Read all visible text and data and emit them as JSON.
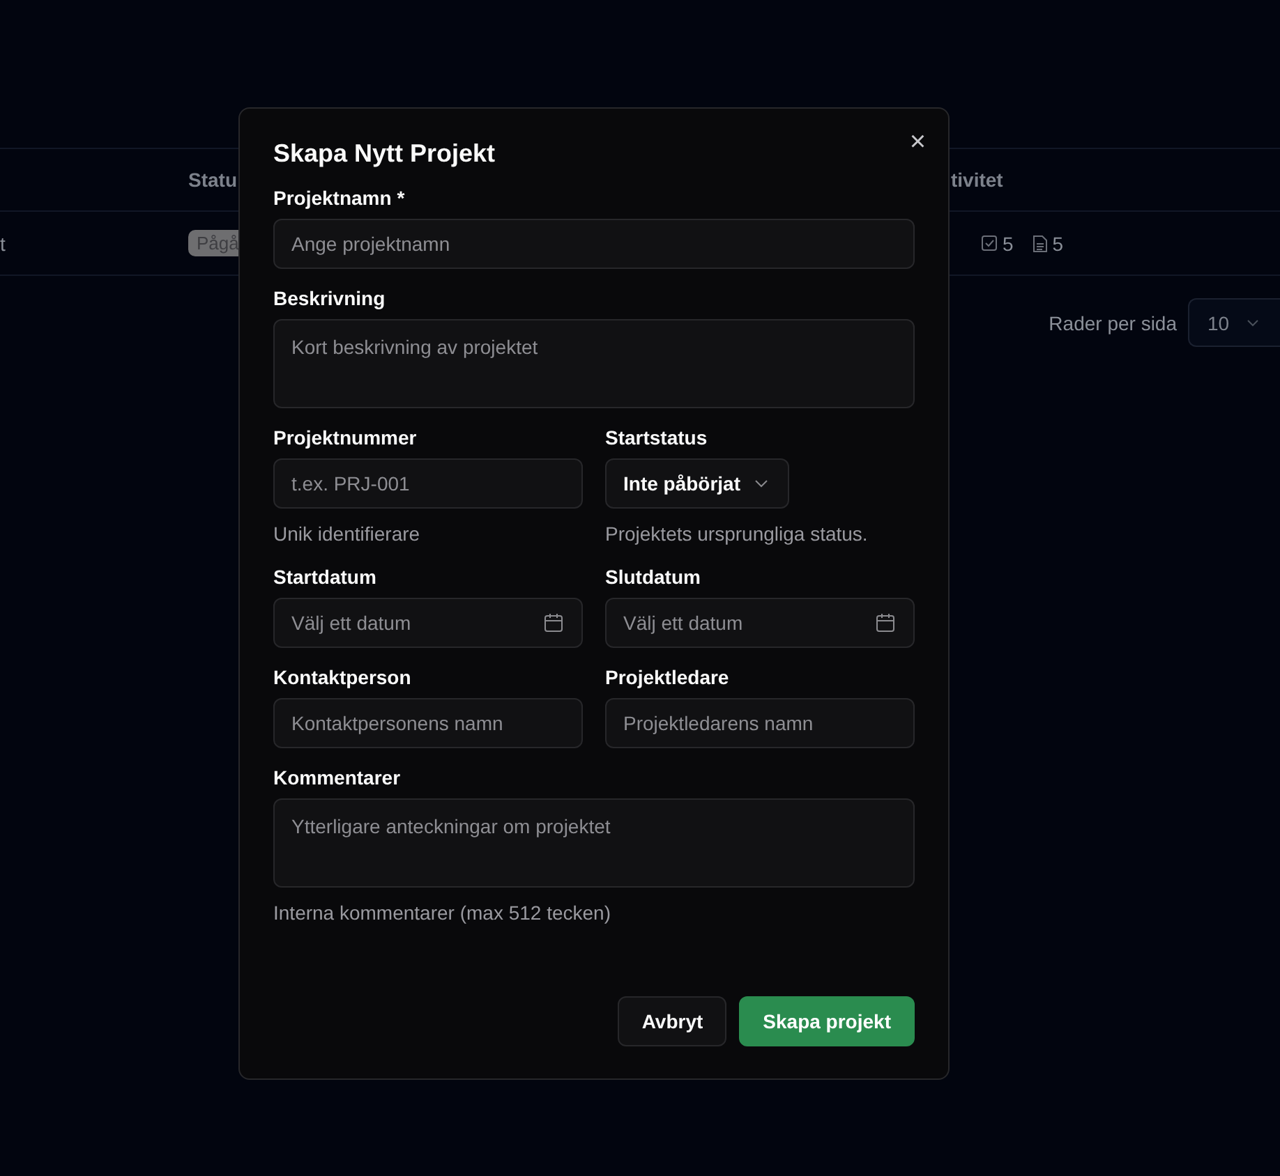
{
  "background": {
    "table": {
      "columns": [
        {
          "label": "Statu"
        },
        {
          "label": "tivitet"
        }
      ],
      "row": {
        "name": "t",
        "status": "Pågå",
        "activity": [
          {
            "kind": "task",
            "count": "5"
          },
          {
            "kind": "document",
            "count": "5"
          }
        ]
      }
    },
    "pagination": {
      "label": "Rader per sida",
      "value": "10"
    }
  },
  "dialog": {
    "title": "Skapa Nytt Projekt",
    "close": "×",
    "rows": [
      [
        {
          "kind": "text",
          "label": "Projektnamn *",
          "placeholder": "Ange projektnamn"
        }
      ],
      [
        {
          "kind": "textarea",
          "label": "Beskrivning",
          "placeholder": "Kort beskrivning av projektet"
        }
      ],
      [
        {
          "kind": "text",
          "label": "Projektnummer",
          "placeholder": "t.ex. PRJ-001",
          "helper": "Unik identifierare"
        },
        {
          "kind": "select",
          "label": "Startstatus",
          "value": "Inte påbörjat",
          "helper": "Projektets ursprungliga status."
        }
      ],
      [
        {
          "kind": "date",
          "label": "Startdatum",
          "placeholder": "Välj ett datum"
        },
        {
          "kind": "date",
          "label": "Slutdatum",
          "placeholder": "Välj ett datum"
        }
      ],
      [
        {
          "kind": "text",
          "label": "Kontaktperson",
          "placeholder": "Kontaktpersonens namn"
        },
        {
          "kind": "text",
          "label": "Projektledare",
          "placeholder": "Projektledarens namn"
        }
      ],
      [
        {
          "kind": "textarea",
          "label": "Kommentarer",
          "placeholder": "Ytterligare anteckningar om projektet",
          "helper": "Interna kommentarer (max 512 tecken)"
        }
      ]
    ],
    "buttons": [
      {
        "kind": "secondary",
        "label": "Avbryt"
      },
      {
        "kind": "primary",
        "label": "Skapa projekt"
      }
    ]
  }
}
